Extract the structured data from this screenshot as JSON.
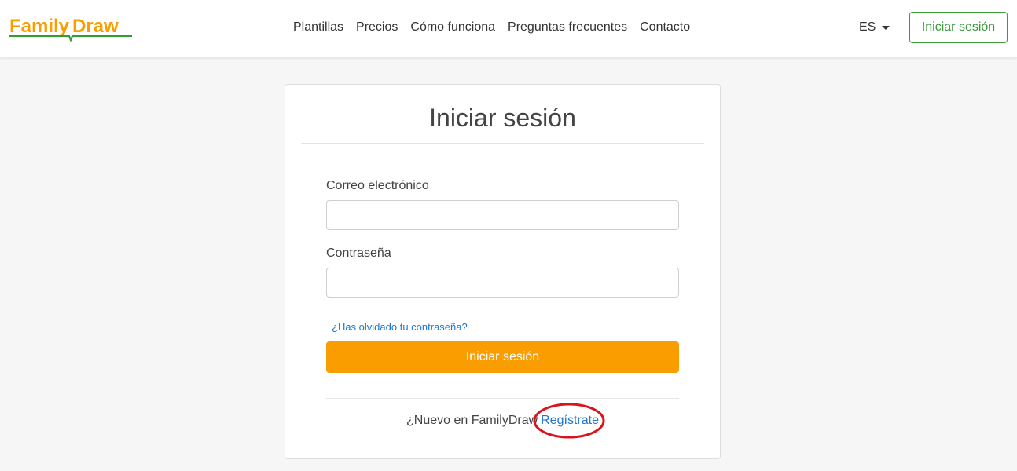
{
  "brand": {
    "logo_text_1": "Family",
    "logo_text_2": "Draw",
    "colors": {
      "orange": "#f99d00",
      "green": "#3a9a3a",
      "link": "#1f77d0",
      "annotation": "#d8141d"
    }
  },
  "nav": {
    "links": [
      "Plantillas",
      "Precios",
      "Cómo funciona",
      "Preguntas frecuentes",
      "Contacto"
    ],
    "language": "ES",
    "login_label": "Iniciar sesión"
  },
  "form": {
    "title": "Iniciar sesión",
    "email_label": "Correo electrónico",
    "email_value": "",
    "password_label": "Contraseña",
    "password_value": "",
    "forgot_label": "¿Has olvidado tu contraseña?",
    "submit_label": "Iniciar sesión",
    "signup_prompt": "¿Nuevo en FamilyDraw",
    "signup_link": "Regístrate"
  }
}
